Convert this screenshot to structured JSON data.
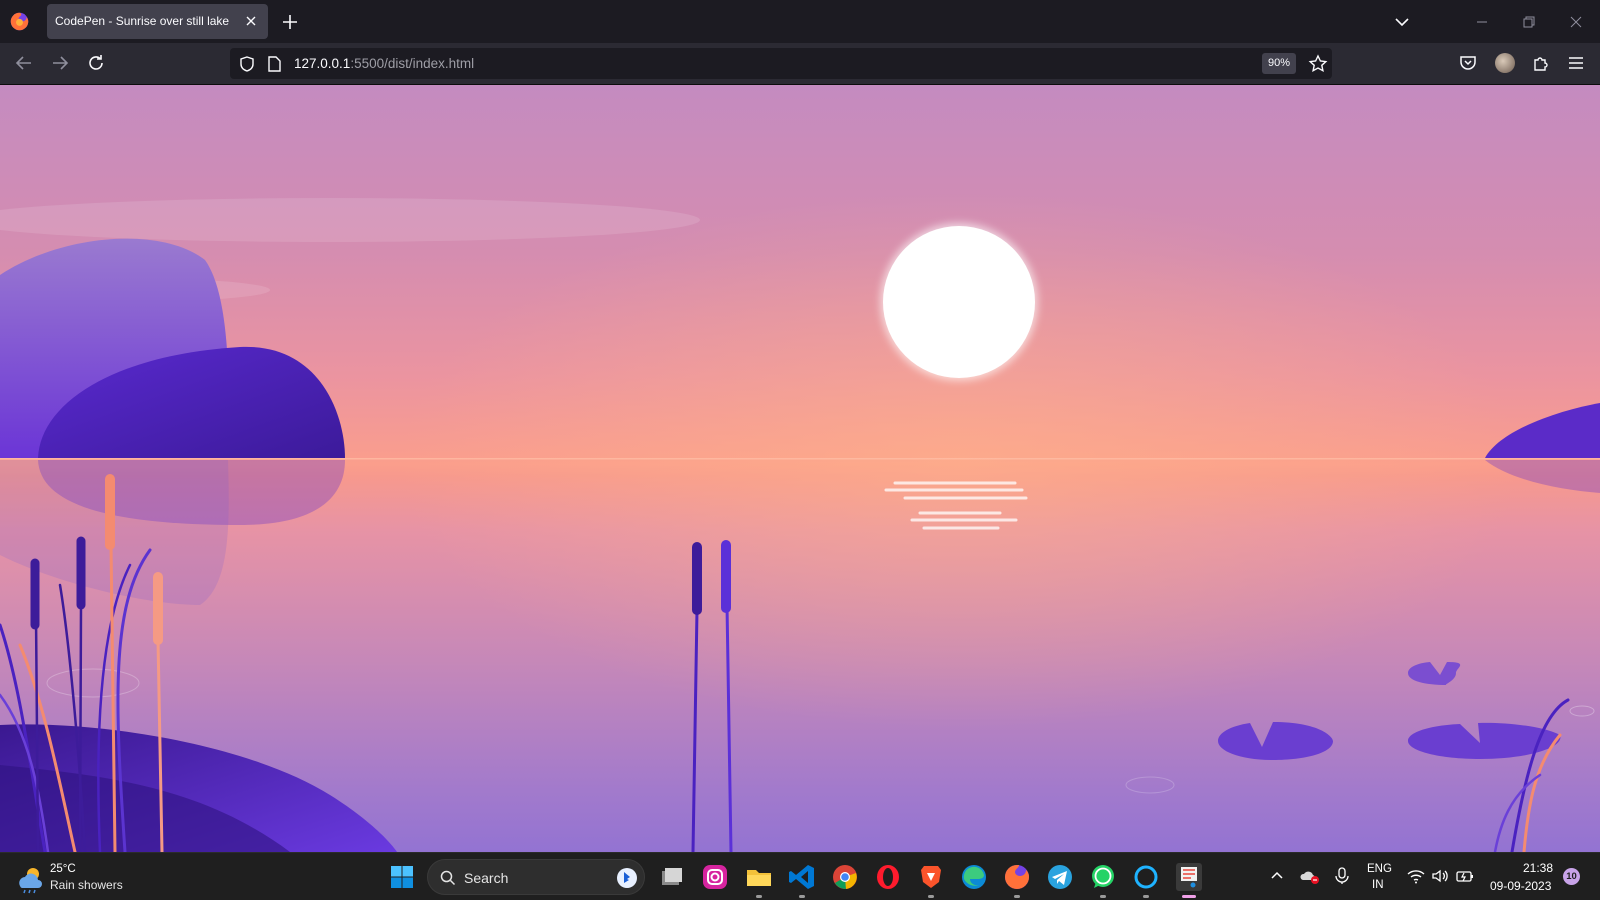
{
  "browser": {
    "tab_title": "CodePen - Sunrise over still lake",
    "url_host": "127.0.0.1",
    "url_path": ":5500/dist/index.html",
    "zoom": "90%"
  },
  "icons": {
    "firefox": "firefox-logo-icon",
    "tab_close": "close-icon",
    "new_tab": "plus-icon",
    "list_tabs": "chevron-down-icon",
    "back": "arrow-left-icon",
    "forward": "arrow-right-icon",
    "reload": "reload-icon",
    "shield": "shield-icon",
    "page": "page-icon",
    "star": "star-icon",
    "pocket": "pocket-icon",
    "extensions": "puzzle-icon",
    "menu": "hamburger-icon"
  },
  "scene": {
    "colors": {
      "sky_top": "#c48bc0",
      "horizon": "#fb9e8c",
      "water_bottom": "#9373d2",
      "sun": "#ffffff",
      "rock_dark": "#4a20b8",
      "rock_light": "#8a5fd6",
      "reed_orange": "#f5896c",
      "lily_pad": "#6a3ed0"
    }
  },
  "taskbar": {
    "weather_temp": "25°C",
    "weather_desc": "Rain showers",
    "search_label": "Search",
    "apps": [
      "file-explorer-window",
      "instagram",
      "file-explorer",
      "vs-code",
      "chrome",
      "opera",
      "brave",
      "edge",
      "firefox",
      "telegram",
      "whatsapp",
      "cortana",
      "snipping-tool"
    ],
    "lang_1": "ENG",
    "lang_2": "IN",
    "time": "21:38",
    "date": "09-09-2023",
    "notifications": "10"
  }
}
